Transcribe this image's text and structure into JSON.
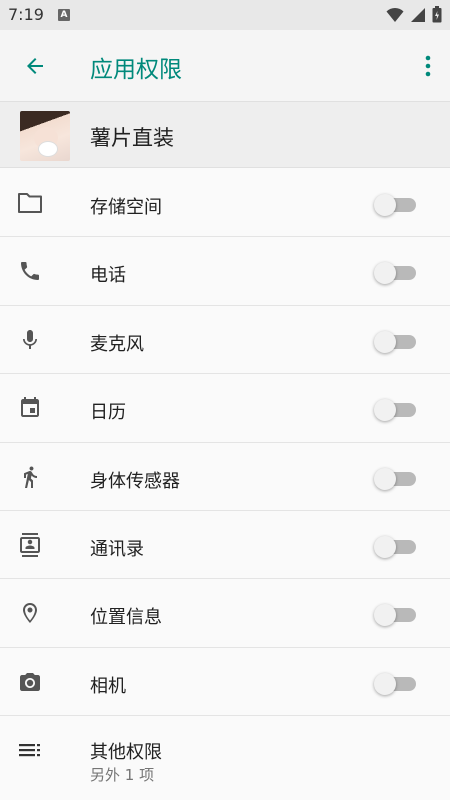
{
  "status_bar": {
    "time": "7:19",
    "notification_glyph": "A",
    "icons": [
      "wifi-icon",
      "signal-icon",
      "battery-icon"
    ]
  },
  "app_bar": {
    "title": "应用权限",
    "accent": "#00897b",
    "back_icon": "arrow-back-icon",
    "more_icon": "more-vert-icon"
  },
  "app": {
    "name": "薯片直装",
    "icon": "app-avatar"
  },
  "permissions": [
    {
      "label": "存储空间",
      "icon": "folder-icon",
      "enabled": false
    },
    {
      "label": "电话",
      "icon": "phone-icon",
      "enabled": false
    },
    {
      "label": "麦克风",
      "icon": "microphone-icon",
      "enabled": false
    },
    {
      "label": "日历",
      "icon": "calendar-icon",
      "enabled": false
    },
    {
      "label": "身体传感器",
      "icon": "body-sensor-icon",
      "enabled": false
    },
    {
      "label": "通讯录",
      "icon": "contacts-icon",
      "enabled": false
    },
    {
      "label": "位置信息",
      "icon": "location-icon",
      "enabled": false
    },
    {
      "label": "相机",
      "icon": "camera-icon",
      "enabled": false
    }
  ],
  "other": {
    "label": "其他权限",
    "sub": "另外 1 项",
    "icon": "list-icon"
  }
}
